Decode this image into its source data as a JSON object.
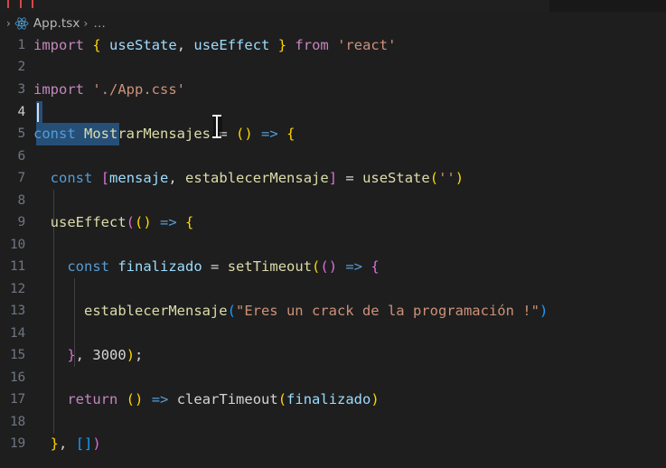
{
  "window": {
    "background_color": "#1e1e1e",
    "tabstrip_color": "#181818"
  },
  "breadcrumb": {
    "leading_chevron": "›",
    "file_icon": "react-icon",
    "file_name": "App.tsx",
    "separator": "›",
    "ellipsis": "…"
  },
  "editor": {
    "language": "typescriptreact",
    "current_line": 4,
    "selection_text": "const Mostrar",
    "line_numbers": [
      1,
      2,
      3,
      4,
      5,
      6,
      7,
      8,
      9,
      10,
      11,
      12,
      13,
      14,
      15,
      16,
      17,
      18,
      19
    ],
    "lines": [
      {
        "num": 1,
        "text": "import { useState, useEffect } from 'react'"
      },
      {
        "num": 2,
        "text": ""
      },
      {
        "num": 3,
        "text": "import './App.css'"
      },
      {
        "num": 4,
        "text": ""
      },
      {
        "num": 5,
        "text": "const MostrarMensajes = () => {"
      },
      {
        "num": 6,
        "text": ""
      },
      {
        "num": 7,
        "text": "  const [mensaje, establecerMensaje] = useState('')"
      },
      {
        "num": 8,
        "text": ""
      },
      {
        "num": 9,
        "text": "  useEffect(() => {"
      },
      {
        "num": 10,
        "text": ""
      },
      {
        "num": 11,
        "text": "    const finalizado = setTimeout(() => {"
      },
      {
        "num": 12,
        "text": ""
      },
      {
        "num": 13,
        "text": "      establecerMensaje(\"Eres un crack de la programación !\")"
      },
      {
        "num": 14,
        "text": ""
      },
      {
        "num": 15,
        "text": "    }, 3000);"
      },
      {
        "num": 16,
        "text": ""
      },
      {
        "num": 17,
        "text": "    return () => clearTimeout(finalizado)"
      },
      {
        "num": 18,
        "text": ""
      },
      {
        "num": 19,
        "text": "  }, [])"
      }
    ],
    "tokens": {
      "l1": {
        "import": "import",
        "brace_open": "{",
        "useState": "useState",
        "comma": ",",
        "useEffect": "useEffect",
        "brace_close": "}",
        "from": "from",
        "module": "'react'"
      },
      "l3": {
        "import": "import",
        "module": "'./App.css'"
      },
      "l5": {
        "const": "const",
        "name": "MostrarMensajes",
        "eq": "=",
        "paren": "()",
        "arrow": "=>",
        "brace": "{"
      },
      "l7": {
        "const": "const",
        "bracket_open": "[",
        "state": "mensaje",
        "comma": ",",
        "setter": "establecerMensaje",
        "bracket_close": "]",
        "eq": "=",
        "hook": "useState",
        "paren_open": "(",
        "str": "''",
        "paren_close": ")"
      },
      "l9": {
        "hook": "useEffect",
        "paren_open": "(",
        "paren": "()",
        "arrow": "=>",
        "brace": "{"
      },
      "l11": {
        "const": "const",
        "name": "finalizado",
        "eq": "=",
        "fn": "setTimeout",
        "paren_open": "(",
        "paren": "()",
        "arrow": "=>",
        "brace": "{"
      },
      "l13": {
        "fn": "establecerMensaje",
        "paren_open": "(",
        "str": "\"Eres un crack de la programación !\"",
        "paren_close": ")"
      },
      "l15": {
        "brace": "}",
        "comma": ",",
        "num": "3000",
        "paren": ")",
        "semi": ";"
      },
      "l17": {
        "return": "return",
        "paren": "()",
        "arrow": "=>",
        "fn": "clearTimeout",
        "paren_open": "(",
        "arg": "finalizado",
        "paren_close": ")"
      },
      "l19": {
        "brace": "}",
        "comma": ",",
        "arr": "[]",
        "paren": ")"
      }
    },
    "colors": {
      "keyword": "#c586c0",
      "const_keyword": "#569cd6",
      "function": "#dcdcaa",
      "variable": "#9cdcfe",
      "string": "#ce9178",
      "number": "#b5cea8",
      "operator": "#d4d4d4",
      "bracket_yellow": "#ffd700",
      "bracket_pink": "#da70d6",
      "bracket_blue": "#179fff",
      "selection": "#264f78",
      "line_number": "#6e7681",
      "line_number_active": "#cfcfcf"
    }
  }
}
